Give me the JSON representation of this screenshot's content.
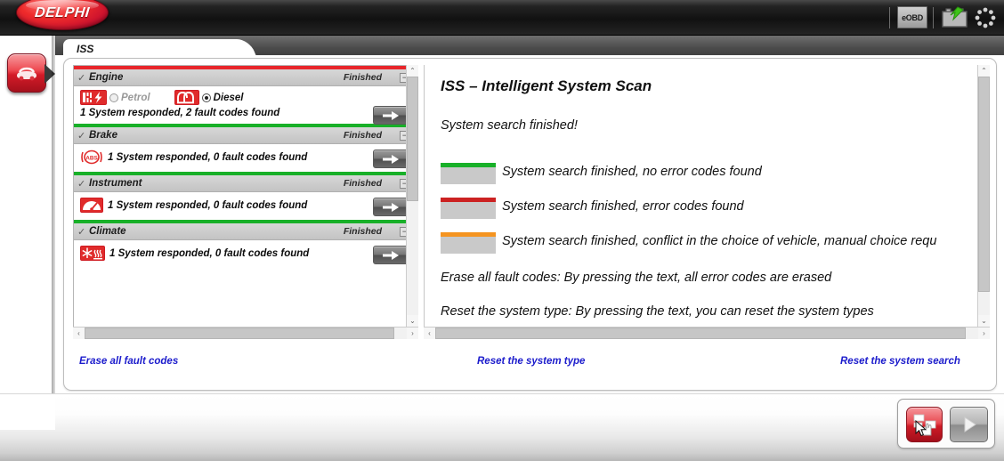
{
  "app": {
    "brand": "DELPHI",
    "topbar_icons": [
      {
        "name": "eobd-icon",
        "label": "eOBD"
      },
      {
        "name": "battery-icon",
        "label": "battery"
      },
      {
        "name": "loading-dots-icon",
        "label": "dots"
      }
    ]
  },
  "tab": {
    "label": "ISS"
  },
  "rail": {
    "vehicle_button": "vehicle",
    "back_button": "back"
  },
  "systems": [
    {
      "name": "Engine",
      "status": "Finished",
      "bar_color": "#e8252a",
      "check": "✓",
      "collapse": "−",
      "message": "1 System responded, 2 fault codes found",
      "icon": "engine-icon",
      "fuel_options": [
        {
          "label": "Petrol",
          "selected": false,
          "icon": "petrol-spark-icon"
        },
        {
          "label": "Diesel",
          "selected": true,
          "icon": "diesel-glowplug-icon"
        }
      ]
    },
    {
      "name": "Brake",
      "status": "Finished",
      "bar_color": "#18b028",
      "check": "✓",
      "collapse": "−",
      "message": "1 System responded, 0 fault codes found",
      "icon": "abs-icon",
      "icon_text": "ABS",
      "fuel_options": []
    },
    {
      "name": "Instrument",
      "status": "Finished",
      "bar_color": "#18b028",
      "check": "✓",
      "collapse": "−",
      "message": "1 System responded, 0 fault codes found",
      "icon": "gauge-icon",
      "fuel_options": []
    },
    {
      "name": "Climate",
      "status": "Finished",
      "bar_color": "#18b028",
      "check": "✓",
      "collapse": "−",
      "message": "1 System responded, 0 fault codes found",
      "icon": "climate-icon",
      "fuel_options": []
    }
  ],
  "info": {
    "title": "ISS – Intelligent System Scan",
    "subtitle": "System search finished!",
    "legend": [
      {
        "color": "#18b028",
        "text": "System search finished, no error codes found"
      },
      {
        "color": "#cc2222",
        "text": "System search finished, error codes found"
      },
      {
        "color": "#f59420",
        "text": "System search finished, conflict in the choice of vehicle, manual choice requ"
      }
    ],
    "lines": [
      "Erase all fault codes: By pressing the text, all error codes are erased",
      "Reset the system type: By pressing the text, you can reset the system types"
    ]
  },
  "links": [
    {
      "label": "Erase all fault codes",
      "name": "erase-all-fault-codes-link"
    },
    {
      "label": "Reset the system type",
      "name": "reset-the-system-type-link"
    },
    {
      "label": "Reset the system search",
      "name": "reset-the-system-search-link"
    }
  ],
  "footer": {
    "snapshot_button": "snapshot",
    "play_button": "play"
  },
  "scroll": {
    "up_arrow": "⌃",
    "down_arrow": "⌄",
    "left_arrow": "‹",
    "right_arrow": "›"
  },
  "colors": {
    "brand_red": "#c8102e",
    "ok_green": "#18b028",
    "error_red": "#cc2222",
    "conflict_orange": "#f59420",
    "link_blue": "#1c1ccc"
  }
}
